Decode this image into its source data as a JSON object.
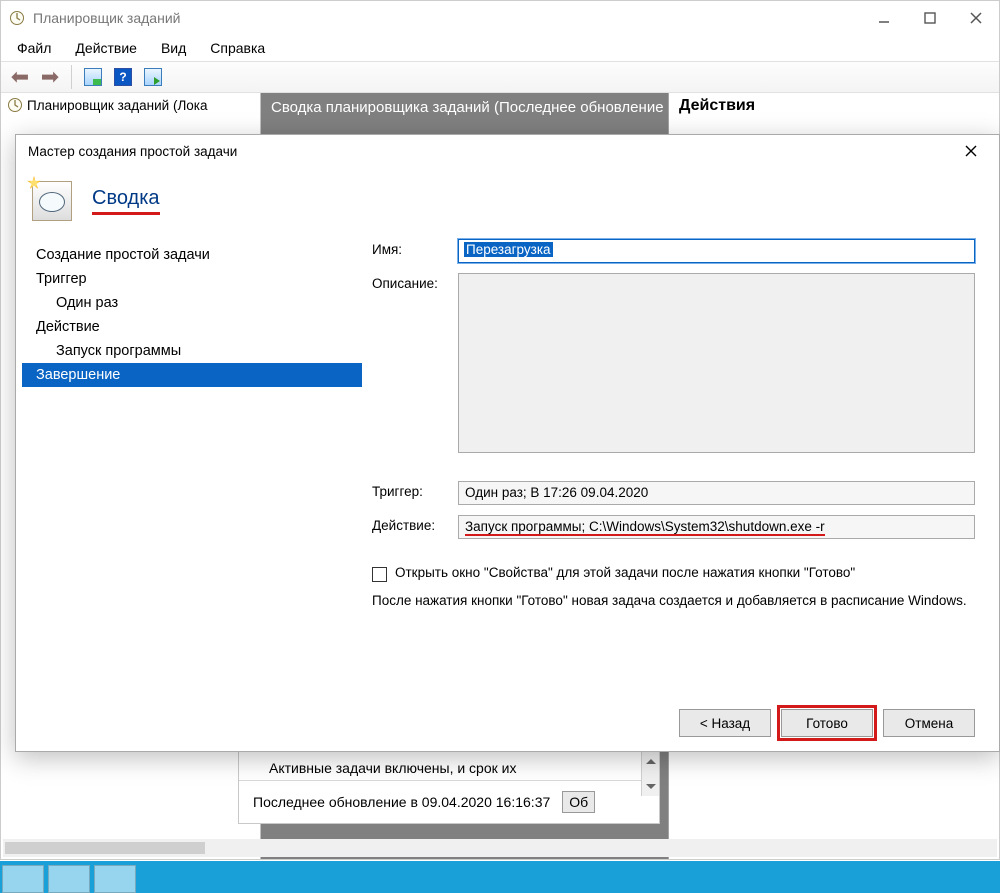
{
  "parent": {
    "title": "Планировщик заданий",
    "menus": [
      "Файл",
      "Действие",
      "Вид",
      "Справка"
    ],
    "tree_root": "Планировщик заданий (Лока",
    "summary_tab": "Сводка планировщика заданий (Последнее обновление",
    "actions_header": "Действия"
  },
  "wizard": {
    "dialog_title": "Мастер создания простой задачи",
    "page_title": "Сводка",
    "steps": {
      "create": "Создание простой задачи",
      "trigger": "Триггер",
      "once": "Один раз",
      "action": "Действие",
      "run_program": "Запуск программы",
      "finish": "Завершение"
    },
    "labels": {
      "name": "Имя:",
      "description": "Описание:",
      "trigger": "Триггер:",
      "action": "Действие:"
    },
    "values": {
      "name": "Перезагрузка",
      "description": "",
      "trigger": "Один раз; В 17:26 09.04.2020",
      "action": "Запуск программы; C:\\Windows\\System32\\shutdown.exe -r"
    },
    "checkbox_label": "Открыть окно \"Свойства\" для этой задачи после нажатия кнопки \"Готово\"",
    "info": "После нажатия кнопки \"Готово\" новая задача создается и добавляется в расписание Windows.",
    "buttons": {
      "back": "< Назад",
      "finish": "Готово",
      "cancel": "Отмена"
    }
  },
  "behind": {
    "active_line": "Активные задачи включены, и срок их",
    "update_line": "Последнее обновление в 09.04.2020 16:16:37",
    "refresh_btn": "Об"
  }
}
